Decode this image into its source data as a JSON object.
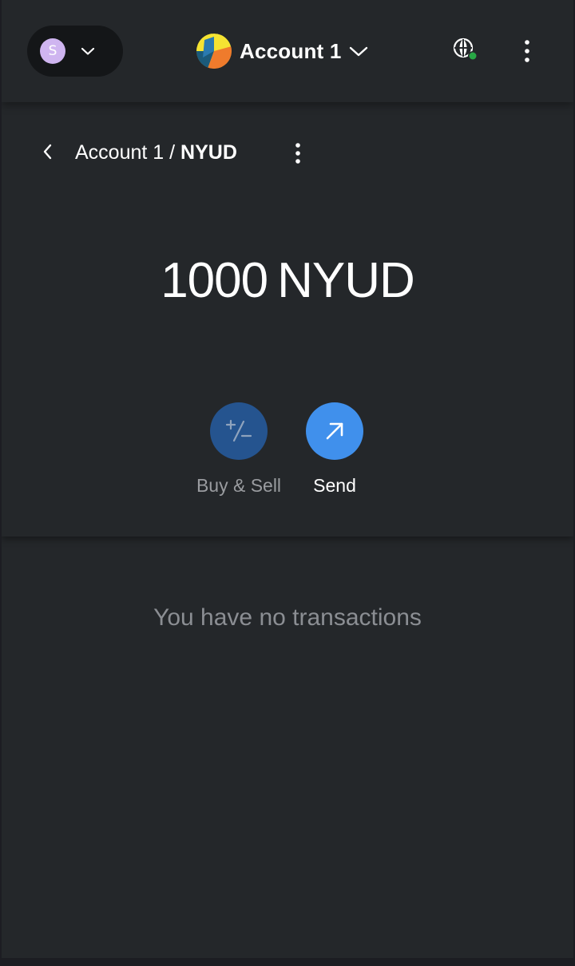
{
  "header": {
    "network_avatar_letter": "S",
    "account_name": "Account 1",
    "icons": {
      "network_dropdown": "chevron-down-icon",
      "account_dropdown": "chevron-down-icon",
      "connection_status": "globe-connected-icon",
      "menu": "vertical-dots-icon"
    }
  },
  "asset": {
    "breadcrumb_account": "Account 1 / ",
    "breadcrumb_token": "NYUD",
    "balance_amount": "1000",
    "balance_unit": "NYUD",
    "icons": {
      "back": "chevron-left-icon",
      "menu": "vertical-dots-icon"
    }
  },
  "actions": [
    {
      "label": "Buy & Sell",
      "icon": "plus-minus-icon",
      "enabled": false
    },
    {
      "label": "Send",
      "icon": "arrow-up-right-icon",
      "enabled": true
    }
  ],
  "transactions": {
    "empty_message": "You have no transactions"
  },
  "colors": {
    "background": "#24272a",
    "primary_blue": "#4090ec",
    "disabled_blue": "#25548f",
    "muted_text": "#8b8e93",
    "connected_dot": "#28a745"
  }
}
